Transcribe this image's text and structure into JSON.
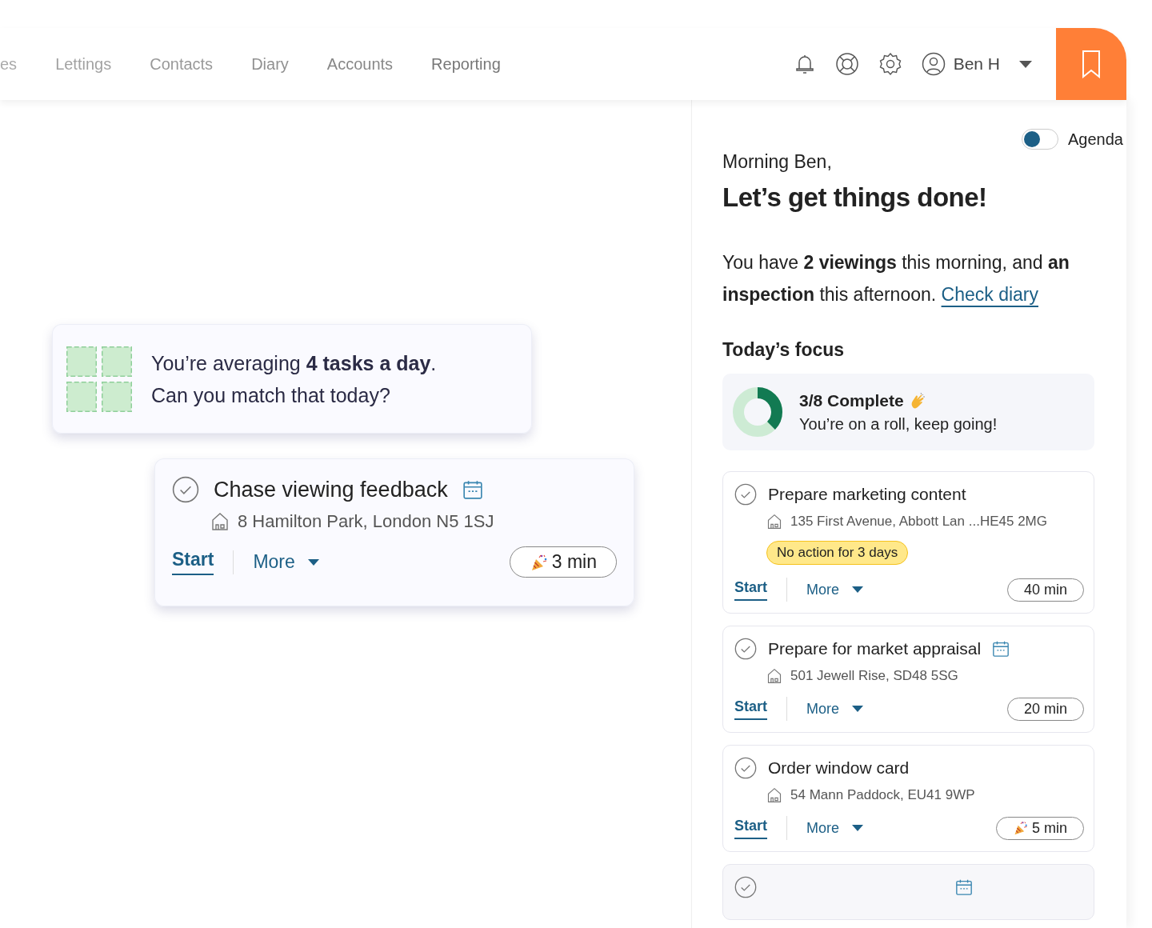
{
  "nav": {
    "items": [
      {
        "label": "es"
      },
      {
        "label": "Lettings"
      },
      {
        "label": "Contacts"
      },
      {
        "label": "Diary"
      },
      {
        "label": "Accounts"
      },
      {
        "label": "Reporting"
      }
    ],
    "user": "Ben H"
  },
  "canvas": {
    "stats_card": {
      "text": "You’re averaging **4 tasks a day**.",
      "text_2": "Can you match that today?"
    },
    "task_card": {
      "title": "Chase viewing feedback",
      "calendar": true,
      "address": "8 Hamilton Park, London N5 1SJ",
      "start": "Start",
      "more": "More",
      "duration": "3 min",
      "celebrate": true
    }
  },
  "panel": {
    "agenda_toggle": {
      "label": "Agenda",
      "on": false
    },
    "greeting": "Morning Ben,",
    "heading": "Let’s get things done!",
    "summary": "You have **2 viewings** this morning, and **an inspection** this afternoon.",
    "summary_link": "Check diary",
    "focus_title": "Today’s focus",
    "progress": {
      "title": "3/8 Complete",
      "subtitle": "You’re on a roll, keep going!",
      "level": 0.375
    },
    "tasks": [
      {
        "title": "Prepare marketing content",
        "calendar": false,
        "address": "135 First Avenue, Abbott Lan ...HE45 2MG",
        "warning": "No action for 3 days",
        "start": "Start",
        "more": "More",
        "duration": "40 min",
        "celebrate": false
      },
      {
        "title": "Prepare for market appraisal",
        "calendar": true,
        "address": "501 Jewell Rise, SD48 5SG",
        "start": "Start",
        "more": "More",
        "duration": "20 min",
        "celebrate": false
      },
      {
        "title": "Order window card",
        "calendar": false,
        "address": "54 Mann Paddock, EU41 9WP",
        "start": "Start",
        "more": "More",
        "duration": "5 min",
        "celebrate": true
      }
    ],
    "partial_task": {
      "calendar": true
    }
  }
}
